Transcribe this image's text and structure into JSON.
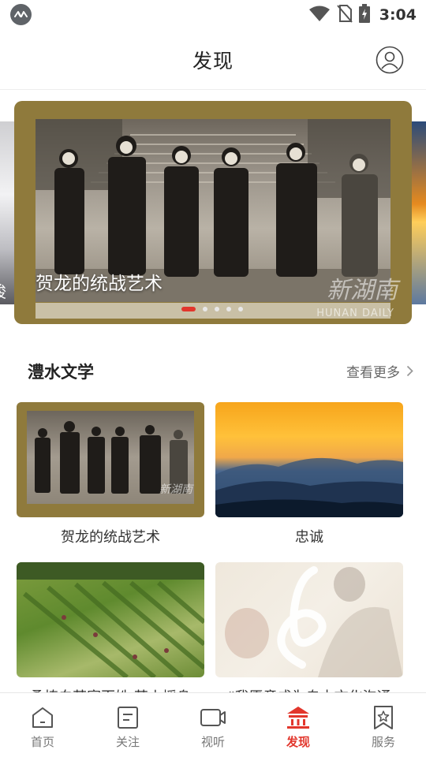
{
  "status_bar": {
    "time": "3:04",
    "icons": [
      "app-notification-icon",
      "wifi-icon",
      "no-sim-icon",
      "battery-charging-icon"
    ]
  },
  "header": {
    "title": "发现",
    "profile_icon": "user-circle-icon"
  },
  "banner": {
    "title": "贺龙的统战艺术",
    "peek_left_text": "竣",
    "watermark": "新湖南",
    "watermark_sub": "HUNAN DAILY",
    "slide_count": 5,
    "active_slide": 1
  },
  "section": {
    "title": "澧水文学",
    "more_label": "查看更多"
  },
  "articles": [
    {
      "title": "贺龙的统战艺术",
      "thumb": "historical-photo"
    },
    {
      "title": "忠诚",
      "thumb": "sunset-mountains"
    },
    {
      "title": "桑植白茶富百姓 茶山摇身",
      "thumb": "tea-garden"
    },
    {
      "title": "“我愿意成为自由文化沟通",
      "thumb": "music-portrait"
    }
  ],
  "tab_bar": {
    "items": [
      {
        "label": "首页",
        "icon": "home-icon",
        "active": false
      },
      {
        "label": "关注",
        "icon": "document-icon",
        "active": false
      },
      {
        "label": "视听",
        "icon": "video-camera-icon",
        "active": false
      },
      {
        "label": "发现",
        "icon": "discover-temple-icon",
        "active": true
      },
      {
        "label": "服务",
        "icon": "bookmark-star-icon",
        "active": false
      }
    ]
  },
  "colors": {
    "accent": "#e2362c",
    "text_primary": "#222222",
    "text_secondary": "#666666"
  }
}
